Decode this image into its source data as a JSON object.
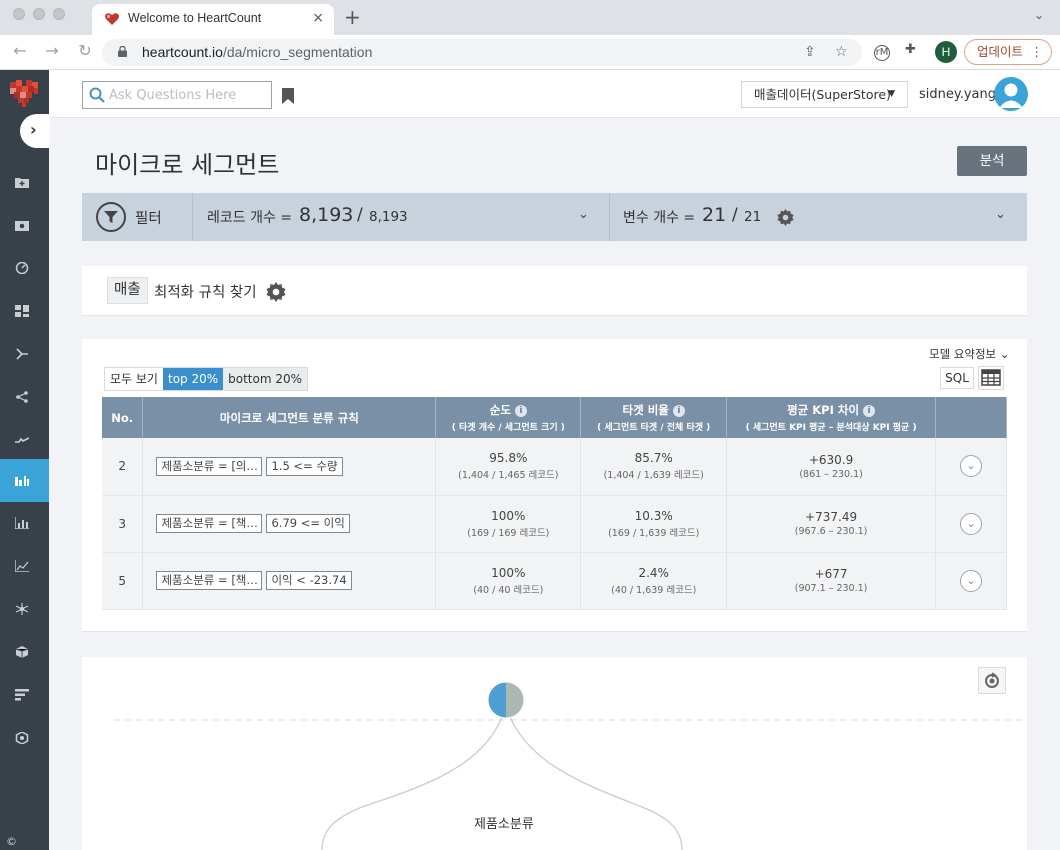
{
  "browser": {
    "tab_title": "Welcome to HeartCount",
    "tab_close": "×",
    "new_tab": "+",
    "url_host": "heartcount.io",
    "url_path": "/da/micro_segmentation",
    "profile_initial": "H",
    "update_label": "업데이트",
    "update_menu": "⋮"
  },
  "header": {
    "search_placeholder": "Ask Questions Here",
    "dataset": "매출데이터(SuperStore)",
    "dataset_caret": "▼",
    "username": "sidney.yang"
  },
  "page": {
    "title": "마이크로 세그먼트",
    "analyze_button": "분석"
  },
  "filter_bar": {
    "label": "필터",
    "record_label": "레코드 개수 =",
    "record_count": "8,193",
    "separator": "/",
    "record_total": "8,193",
    "var_label": "변수 개수 =",
    "var_count": "21",
    "var_total": "21",
    "chevron": "⌄"
  },
  "kpi": {
    "tag": "매출",
    "rule_label": "최적화 규칙 찾기"
  },
  "results": {
    "model_summary": "모델 요약정보 ⌄",
    "toggles": [
      "모두 보기",
      "top 20%",
      "bottom 20%"
    ],
    "active_toggle": "top 20%",
    "sql_label": "SQL",
    "columns": {
      "no": "No.",
      "rule": "마이크로 세그먼트 분류 규칙",
      "purity": "순도",
      "purity_sub": "( 타겟 개수 / 세그먼트 크기 )",
      "ratio": "타겟 비율",
      "ratio_sub": "( 세그먼트 타겟 / 전체 타겟 )",
      "kpi_diff": "평균 KPI 차이",
      "kpi_diff_sub": "( 세그먼트 KPI 평균 – 분석대상 KPI 평균 )",
      "info": "i"
    },
    "rows": [
      {
        "no": "2",
        "rule_a": "제품소분류 = [의…",
        "rule_b": "1.5 <= 수량",
        "purity": "95.8%",
        "purity_detail": "(1,404 / 1,465 레코드)",
        "ratio": "85.7%",
        "ratio_detail": "(1,404 / 1,639 레코드)",
        "kpi": "+630.9",
        "kpi_detail": "(861 – 230.1)",
        "expand": "⌄"
      },
      {
        "no": "3",
        "rule_a": "제품소분류 = [책…",
        "rule_b": "6.79 <= 이익",
        "purity": "100%",
        "purity_detail": "(169 / 169 레코드)",
        "ratio": "10.3%",
        "ratio_detail": "(169 / 1,639 레코드)",
        "kpi": "+737.49",
        "kpi_detail": "(967.6 – 230.1)",
        "expand": "⌄"
      },
      {
        "no": "5",
        "rule_a": "제품소분류 = [책…",
        "rule_b": "이익 < -23.74",
        "purity": "100%",
        "purity_detail": "(40 / 40 레코드)",
        "ratio": "2.4%",
        "ratio_detail": "(40 / 1,639 레코드)",
        "kpi": "+677",
        "kpi_detail": "(907.1 – 230.1)",
        "expand": "⌄"
      }
    ]
  },
  "tree": {
    "node_label": "제품소분류"
  },
  "sidebar": {
    "copyright": "©"
  },
  "colors": {
    "accent": "#3aa4d8",
    "sidebar": "#38414a",
    "table_header": "#7a90a6",
    "filter_bar": "#c8d2dc"
  }
}
